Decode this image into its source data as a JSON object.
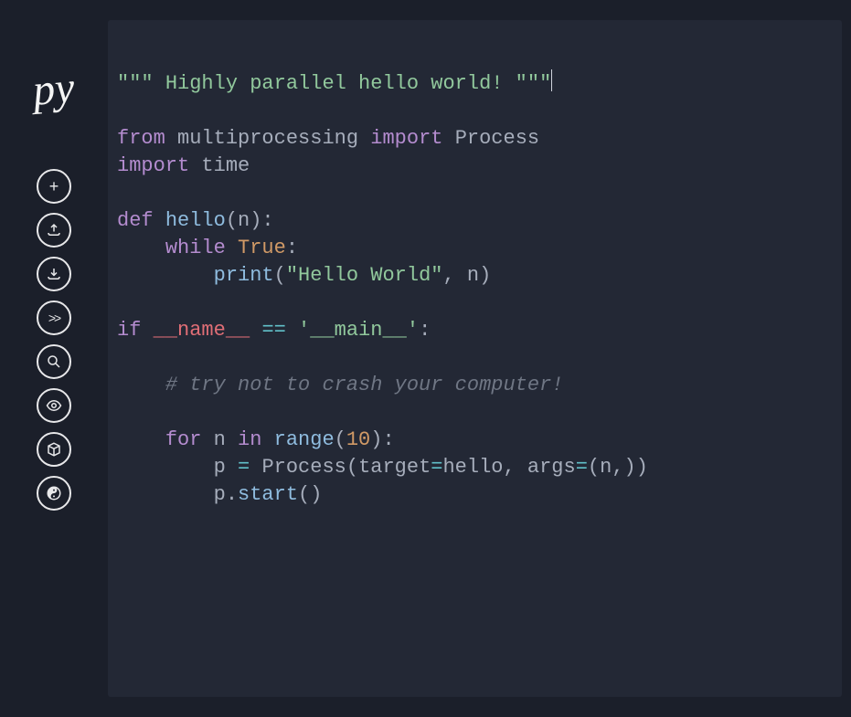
{
  "app": {
    "logo": "py"
  },
  "toolbar": {
    "new": {
      "name": "new-button",
      "icon": "plus-icon"
    },
    "upload": {
      "name": "upload-button",
      "icon": "upload-icon"
    },
    "download": {
      "name": "download-button",
      "icon": "download-icon"
    },
    "run": {
      "name": "run-button",
      "icon": "chevrons-right-icon"
    },
    "search": {
      "name": "search-button",
      "icon": "search-icon"
    },
    "view": {
      "name": "view-button",
      "icon": "eye-icon"
    },
    "package": {
      "name": "package-button",
      "icon": "package-icon"
    },
    "theme": {
      "name": "theme-button",
      "icon": "yin-yang-icon"
    }
  },
  "code": {
    "docstring_open": "\"\"\" ",
    "docstring_text": "Highly parallel hello world!",
    "docstring_close": " \"\"\"",
    "kw_from": "from",
    "mod_mp": "multiprocessing",
    "kw_import": "import",
    "cls_process": "Process",
    "kw_import2": "import",
    "mod_time": "time",
    "kw_def": "def",
    "fn_hello": "hello",
    "param_n": "n",
    "kw_while": "while",
    "const_true": "True",
    "fn_print": "print",
    "str_hello": "\"Hello World\"",
    "kw_if": "if",
    "dunder_name": "__name__",
    "op_eq": "==",
    "str_main": "'__main__'",
    "comment": "# try not to crash your computer!",
    "kw_for": "for",
    "var_n": "n",
    "kw_in": "in",
    "fn_range": "range",
    "num_10": "10",
    "var_p": "p",
    "op_assign": "=",
    "arg_target": "target",
    "arg_args": "args",
    "method_start": "start",
    "p_dot": "p"
  }
}
